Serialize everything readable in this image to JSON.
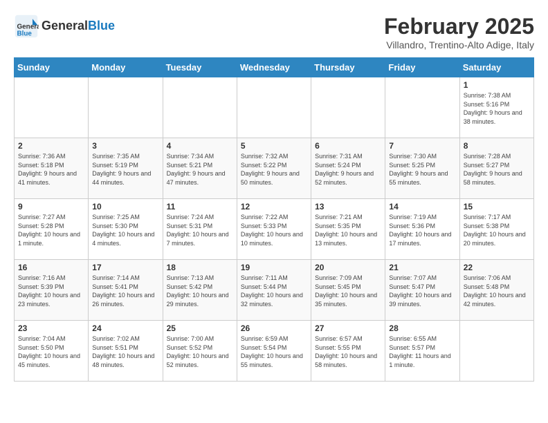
{
  "header": {
    "logo_line1": "General",
    "logo_line2": "Blue",
    "title": "February 2025",
    "subtitle": "Villandro, Trentino-Alto Adige, Italy"
  },
  "days_of_week": [
    "Sunday",
    "Monday",
    "Tuesday",
    "Wednesday",
    "Thursday",
    "Friday",
    "Saturday"
  ],
  "weeks": [
    [
      {
        "day": "",
        "info": ""
      },
      {
        "day": "",
        "info": ""
      },
      {
        "day": "",
        "info": ""
      },
      {
        "day": "",
        "info": ""
      },
      {
        "day": "",
        "info": ""
      },
      {
        "day": "",
        "info": ""
      },
      {
        "day": "1",
        "info": "Sunrise: 7:38 AM\nSunset: 5:16 PM\nDaylight: 9 hours and 38 minutes."
      }
    ],
    [
      {
        "day": "2",
        "info": "Sunrise: 7:36 AM\nSunset: 5:18 PM\nDaylight: 9 hours and 41 minutes."
      },
      {
        "day": "3",
        "info": "Sunrise: 7:35 AM\nSunset: 5:19 PM\nDaylight: 9 hours and 44 minutes."
      },
      {
        "day": "4",
        "info": "Sunrise: 7:34 AM\nSunset: 5:21 PM\nDaylight: 9 hours and 47 minutes."
      },
      {
        "day": "5",
        "info": "Sunrise: 7:32 AM\nSunset: 5:22 PM\nDaylight: 9 hours and 50 minutes."
      },
      {
        "day": "6",
        "info": "Sunrise: 7:31 AM\nSunset: 5:24 PM\nDaylight: 9 hours and 52 minutes."
      },
      {
        "day": "7",
        "info": "Sunrise: 7:30 AM\nSunset: 5:25 PM\nDaylight: 9 hours and 55 minutes."
      },
      {
        "day": "8",
        "info": "Sunrise: 7:28 AM\nSunset: 5:27 PM\nDaylight: 9 hours and 58 minutes."
      }
    ],
    [
      {
        "day": "9",
        "info": "Sunrise: 7:27 AM\nSunset: 5:28 PM\nDaylight: 10 hours and 1 minute."
      },
      {
        "day": "10",
        "info": "Sunrise: 7:25 AM\nSunset: 5:30 PM\nDaylight: 10 hours and 4 minutes."
      },
      {
        "day": "11",
        "info": "Sunrise: 7:24 AM\nSunset: 5:31 PM\nDaylight: 10 hours and 7 minutes."
      },
      {
        "day": "12",
        "info": "Sunrise: 7:22 AM\nSunset: 5:33 PM\nDaylight: 10 hours and 10 minutes."
      },
      {
        "day": "13",
        "info": "Sunrise: 7:21 AM\nSunset: 5:35 PM\nDaylight: 10 hours and 13 minutes."
      },
      {
        "day": "14",
        "info": "Sunrise: 7:19 AM\nSunset: 5:36 PM\nDaylight: 10 hours and 17 minutes."
      },
      {
        "day": "15",
        "info": "Sunrise: 7:17 AM\nSunset: 5:38 PM\nDaylight: 10 hours and 20 minutes."
      }
    ],
    [
      {
        "day": "16",
        "info": "Sunrise: 7:16 AM\nSunset: 5:39 PM\nDaylight: 10 hours and 23 minutes."
      },
      {
        "day": "17",
        "info": "Sunrise: 7:14 AM\nSunset: 5:41 PM\nDaylight: 10 hours and 26 minutes."
      },
      {
        "day": "18",
        "info": "Sunrise: 7:13 AM\nSunset: 5:42 PM\nDaylight: 10 hours and 29 minutes."
      },
      {
        "day": "19",
        "info": "Sunrise: 7:11 AM\nSunset: 5:44 PM\nDaylight: 10 hours and 32 minutes."
      },
      {
        "day": "20",
        "info": "Sunrise: 7:09 AM\nSunset: 5:45 PM\nDaylight: 10 hours and 35 minutes."
      },
      {
        "day": "21",
        "info": "Sunrise: 7:07 AM\nSunset: 5:47 PM\nDaylight: 10 hours and 39 minutes."
      },
      {
        "day": "22",
        "info": "Sunrise: 7:06 AM\nSunset: 5:48 PM\nDaylight: 10 hours and 42 minutes."
      }
    ],
    [
      {
        "day": "23",
        "info": "Sunrise: 7:04 AM\nSunset: 5:50 PM\nDaylight: 10 hours and 45 minutes."
      },
      {
        "day": "24",
        "info": "Sunrise: 7:02 AM\nSunset: 5:51 PM\nDaylight: 10 hours and 48 minutes."
      },
      {
        "day": "25",
        "info": "Sunrise: 7:00 AM\nSunset: 5:52 PM\nDaylight: 10 hours and 52 minutes."
      },
      {
        "day": "26",
        "info": "Sunrise: 6:59 AM\nSunset: 5:54 PM\nDaylight: 10 hours and 55 minutes."
      },
      {
        "day": "27",
        "info": "Sunrise: 6:57 AM\nSunset: 5:55 PM\nDaylight: 10 hours and 58 minutes."
      },
      {
        "day": "28",
        "info": "Sunrise: 6:55 AM\nSunset: 5:57 PM\nDaylight: 11 hours and 1 minute."
      },
      {
        "day": "",
        "info": ""
      }
    ]
  ]
}
